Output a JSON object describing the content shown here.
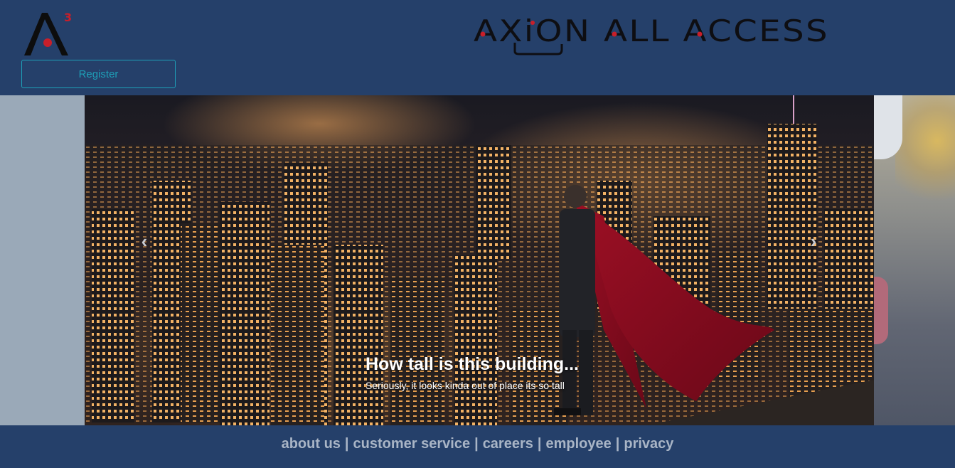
{
  "header": {
    "logo_superscript": "3",
    "register_label": "Register",
    "brand_name": "AXiON ALL ACCESS"
  },
  "carousel": {
    "prev_icon": "chevron-left-icon",
    "next_icon": "chevron-right-icon",
    "caption_title": "How tall is this building...",
    "caption_text": "Seriously, it looks kinda out of place its so tall"
  },
  "footer": {
    "links": [
      "about us",
      "customer service",
      "careers",
      "employee",
      "privacy"
    ],
    "separator": "|"
  },
  "colors": {
    "header_bg": "#25406a",
    "register_accent": "#1e9fb7",
    "logo_red": "#c81f2a",
    "footer_text": "#a9b5c6"
  }
}
